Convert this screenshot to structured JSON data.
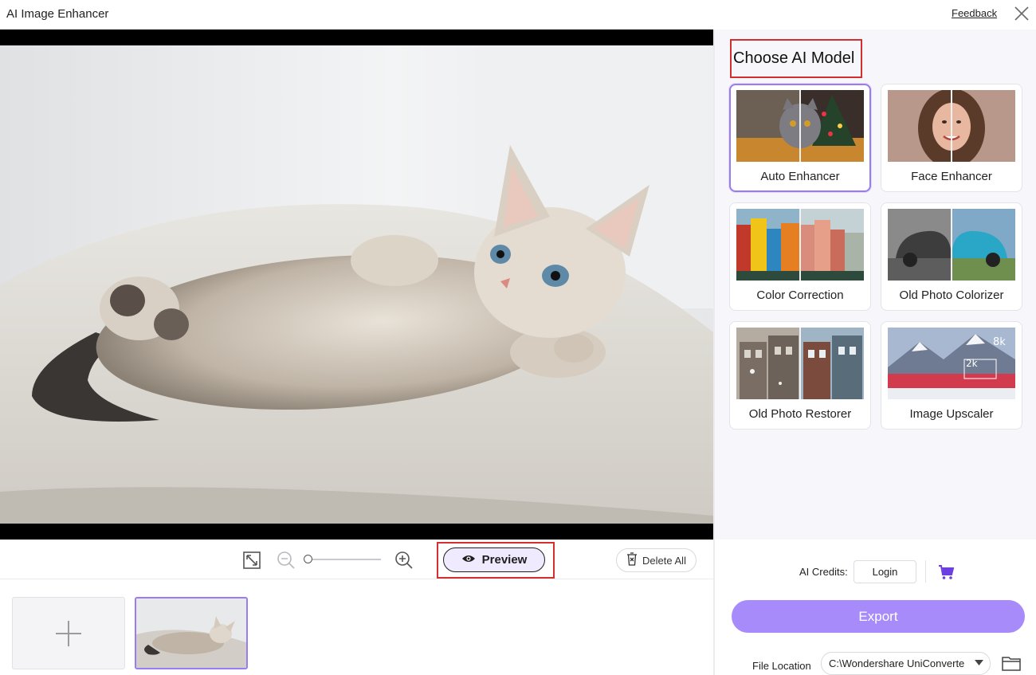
{
  "window": {
    "title": "AI Image Enhancer",
    "feedback_label": "Feedback",
    "close_icon": "close-icon"
  },
  "preview": {
    "image": "kitten-lying-on-white-rug",
    "toolbar": {
      "fit_icon": "fit-screen-icon",
      "zoom_out_icon": "zoom-out-icon",
      "zoom_in_icon": "zoom-in-icon",
      "zoom_level": 0,
      "preview_label": "Preview",
      "preview_icon": "eye-icon",
      "delete_all_label": "Delete All",
      "delete_icon": "trash-icon"
    }
  },
  "thumbnails": {
    "add_icon": "plus-icon",
    "items": [
      {
        "name": "kitten-thumbnail",
        "selected": true
      }
    ]
  },
  "models": {
    "title": "Choose AI Model",
    "items": [
      {
        "label": "Auto Enhancer",
        "selected": true
      },
      {
        "label": "Face Enhancer",
        "selected": false
      },
      {
        "label": "Color Correction",
        "selected": false
      },
      {
        "label": "Old Photo Colorizer",
        "selected": false
      },
      {
        "label": "Old Photo Restorer",
        "selected": false
      },
      {
        "label": "Image Upscaler",
        "selected": false
      }
    ]
  },
  "footer": {
    "credits_label": "AI Credits:",
    "login_label": "Login",
    "cart_icon": "cart-icon",
    "export_label": "Export",
    "file_location_label": "File Location",
    "file_location_value": "C:\\Wondershare UniConverte",
    "folder_icon": "folder-icon"
  },
  "colors": {
    "accent": "#a78bfa",
    "accent_border": "#9b7cf0",
    "highlight_box": "#d32f2f",
    "panel_bg": "#f7f7fb"
  }
}
